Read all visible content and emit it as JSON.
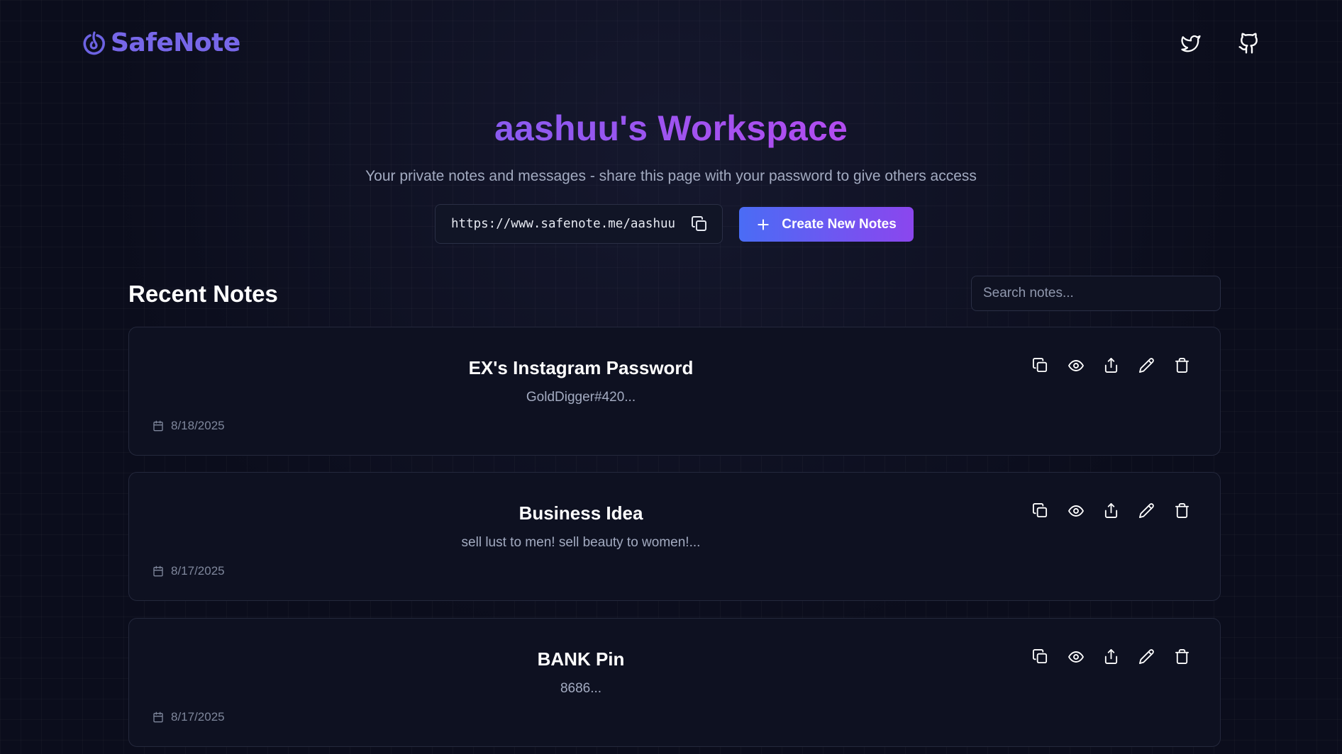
{
  "header": {
    "logo_text": "SafeNote",
    "logo_icon": "power-swirl-icon",
    "twitter_icon": "twitter-icon",
    "github_icon": "github-icon"
  },
  "hero": {
    "title": "aashuu's Workspace",
    "subtitle": "Your private notes and messages - share this page with your password to give others access",
    "url": "https://www.safenote.me/aashuu",
    "create_button_label": "Create New Notes"
  },
  "notes_section": {
    "title": "Recent Notes",
    "search_placeholder": "Search notes..."
  },
  "notes": [
    {
      "title": "EX's Instagram Password",
      "preview": "GoldDigger#420...",
      "date": "8/18/2025"
    },
    {
      "title": "Business Idea",
      "preview": "sell lust to men! sell beauty to women!...",
      "date": "8/17/2025"
    },
    {
      "title": "BANK Pin",
      "preview": "8686...",
      "date": "8/17/2025"
    }
  ],
  "colors": {
    "background": "#0b0d1c",
    "card": "#0e1121",
    "accent_start": "#4a6cf5",
    "accent_end": "#8b46ee",
    "title_purple": "#9b5cf0",
    "logo": "#7767e8"
  }
}
